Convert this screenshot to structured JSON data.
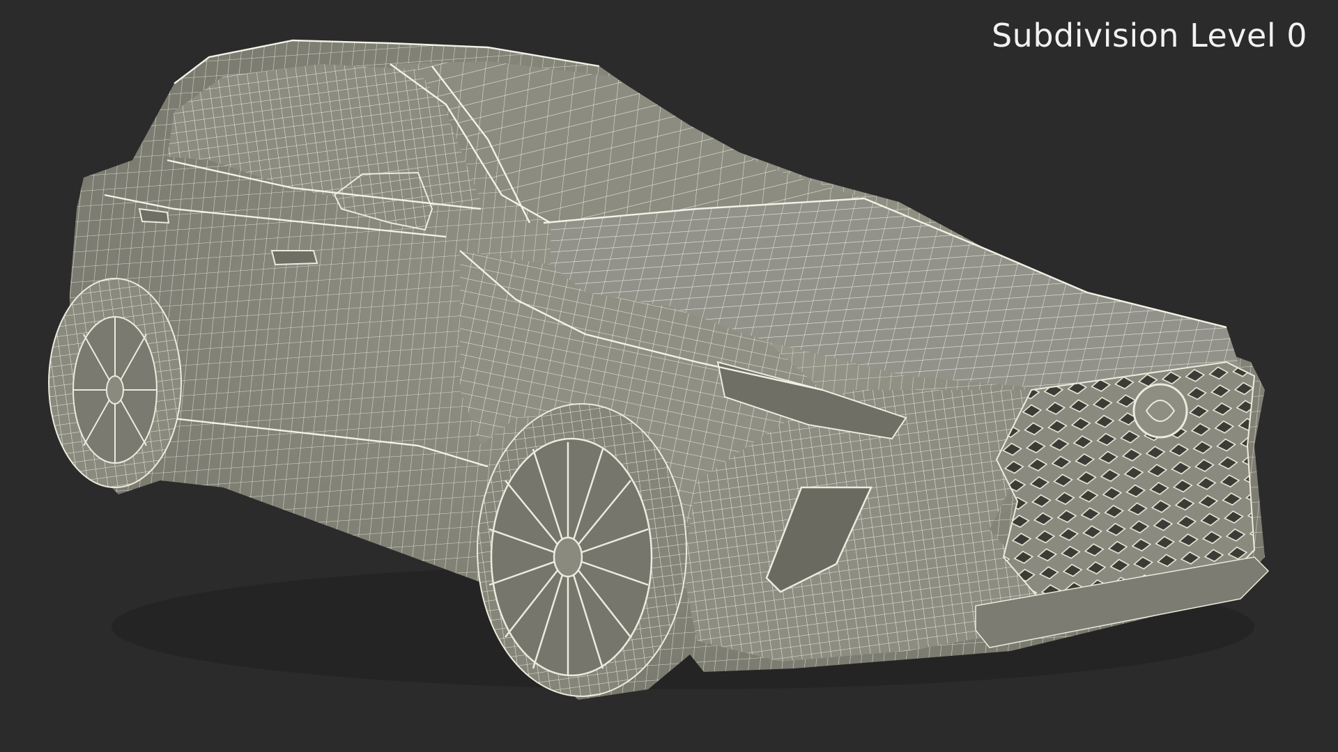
{
  "caption": {
    "text": "Subdivision Level 0"
  },
  "colors": {
    "background": "#2b2b2b",
    "surface": "#8a8a7e",
    "wire": "#ecebdd",
    "shadow": "#56564f"
  },
  "subject": {
    "render_style": "wireframe-over-shaded"
  }
}
